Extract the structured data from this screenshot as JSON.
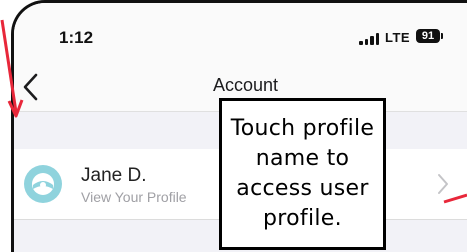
{
  "status_bar": {
    "time": "1:12",
    "network": "LTE",
    "battery": "91"
  },
  "nav": {
    "title": "Account",
    "back_icon": "chevron-left-icon"
  },
  "profile": {
    "name": "Jane D.",
    "subtitle": "View Your Profile",
    "avatar_icon": "avatar-icon",
    "chevron_icon": "chevron-right-icon"
  },
  "annotation": {
    "text": "Touch profile\nname to\naccess user\nprofile."
  },
  "colors": {
    "annotation_arrow": "#e8273a",
    "avatar_teal": "#8fd3dd",
    "background": "#f2f2f7"
  }
}
